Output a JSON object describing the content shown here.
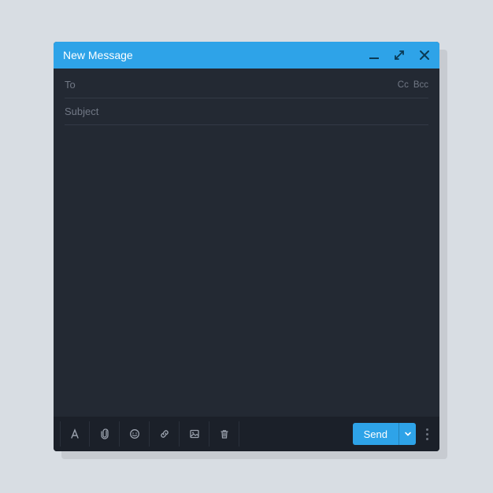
{
  "colors": {
    "accent": "#2ea3e8",
    "bg": "#232933",
    "toolbar": "#1b2029",
    "muted": "#717885"
  },
  "titlebar": {
    "title": "New Message"
  },
  "fields": {
    "to_label": "To",
    "to_value": "",
    "cc_label": "Cc",
    "bcc_label": "Bcc",
    "subject_label": "Subject",
    "subject_value": ""
  },
  "body": {
    "value": ""
  },
  "toolbar": {
    "send_label": "Send"
  }
}
